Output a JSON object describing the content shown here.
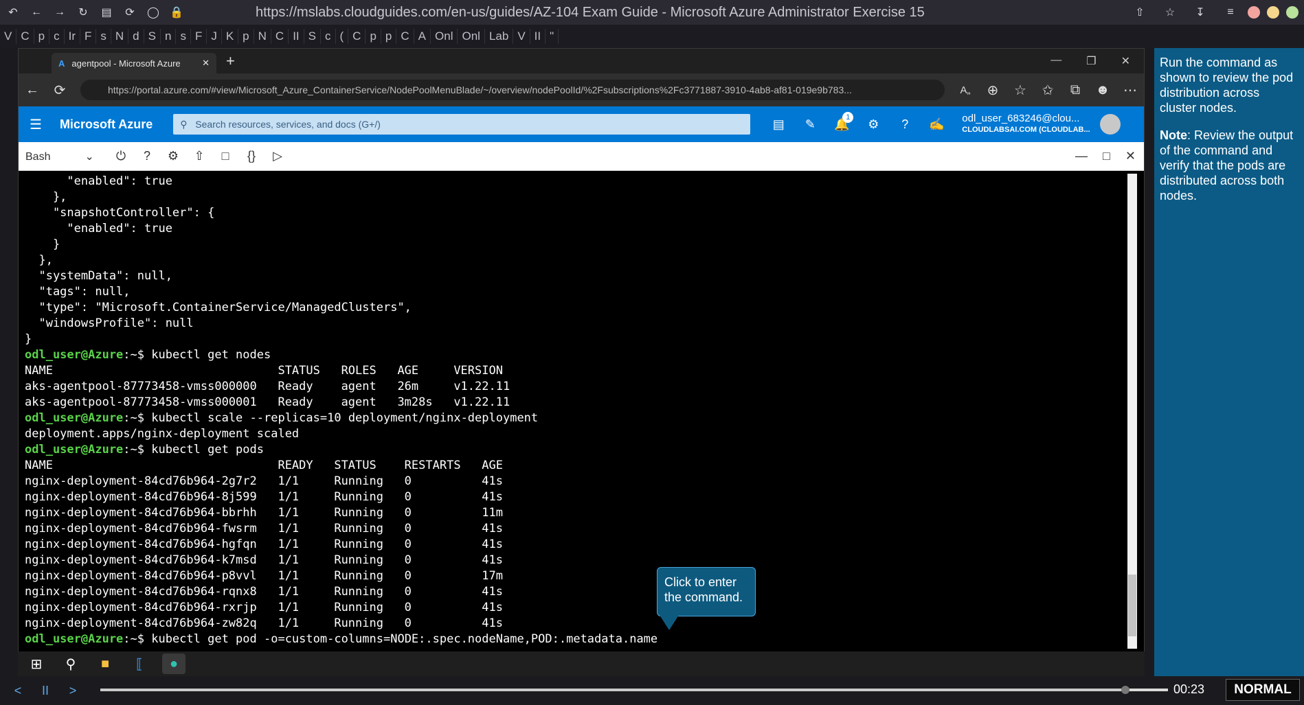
{
  "outer_browser": {
    "url": "https://mslabs.cloudguides.com/en-us/guides/AZ-104 Exam Guide - Microsoft Azure Administrator Exercise 15",
    "bookmarks": [
      "V",
      "C",
      "p",
      "c",
      "Ir",
      "F",
      "s",
      "N",
      "d",
      "S",
      "n",
      "s",
      "F",
      "J",
      "K",
      "p",
      "N",
      "C",
      "II",
      "S",
      "c",
      "(",
      "C",
      "p",
      "p",
      "C",
      "A",
      "Onl",
      "Onl",
      "Lab",
      "V",
      "II",
      "\""
    ]
  },
  "edge": {
    "tab_title": "agentpool - Microsoft Azure",
    "url": "https://portal.azure.com/#view/Microsoft_Azure_ContainerService/NodePoolMenuBlade/~/overview/nodePoolId/%2Fsubscriptions%2Fc3771887-3910-4ab8-af81-019e9b783..."
  },
  "azure": {
    "title": "Microsoft Azure",
    "search_placeholder": "Search resources, services, and docs (G+/)",
    "notification_count": "1",
    "user_name": "odl_user_683246@clou...",
    "user_org": "CLOUDLABSAI.COM (CLOUDLAB..."
  },
  "cloudshell": {
    "shell": "Bash"
  },
  "terminal": {
    "lines": [
      "      \"enabled\": true",
      "    },",
      "    \"snapshotController\": {",
      "      \"enabled\": true",
      "    }",
      "  },",
      "  \"systemData\": null,",
      "  \"tags\": null,",
      "  \"type\": \"Microsoft.ContainerService/ManagedClusters\",",
      "  \"windowsProfile\": null",
      "}",
      {
        "prompt": "odl_user@Azure",
        "cmd": ":~$ kubectl get nodes"
      },
      "NAME                                STATUS   ROLES   AGE     VERSION",
      "aks-agentpool-87773458-vmss000000   Ready    agent   26m     v1.22.11",
      "aks-agentpool-87773458-vmss000001   Ready    agent   3m28s   v1.22.11",
      {
        "prompt": "odl_user@Azure",
        "cmd": ":~$ kubectl scale --replicas=10 deployment/nginx-deployment"
      },
      "deployment.apps/nginx-deployment scaled",
      {
        "prompt": "odl_user@Azure",
        "cmd": ":~$ kubectl get pods"
      },
      "NAME                                READY   STATUS    RESTARTS   AGE",
      "nginx-deployment-84cd76b964-2g7r2   1/1     Running   0          41s",
      "nginx-deployment-84cd76b964-8j599   1/1     Running   0          41s",
      "nginx-deployment-84cd76b964-bbrhh   1/1     Running   0          11m",
      "nginx-deployment-84cd76b964-fwsrm   1/1     Running   0          41s",
      "nginx-deployment-84cd76b964-hgfqn   1/1     Running   0          41s",
      "nginx-deployment-84cd76b964-k7msd   1/1     Running   0          41s",
      "nginx-deployment-84cd76b964-p8vvl   1/1     Running   0          17m",
      "nginx-deployment-84cd76b964-rqnx8   1/1     Running   0          41s",
      "nginx-deployment-84cd76b964-rxrjp   1/1     Running   0          41s",
      "nginx-deployment-84cd76b964-zw82q   1/1     Running   0          41s",
      {
        "prompt": "odl_user@Azure",
        "cmd": ":~$ kubectl get pod -o=custom-columns=NODE:.spec.nodeName,POD:.metadata.name"
      }
    ]
  },
  "callout": {
    "text": "Click to enter the command."
  },
  "sidebar": {
    "instruction": "Run the command as shown to review the pod distribution across cluster nodes.",
    "note_label": "Note",
    "note_text": ": Review the output of the command and verify that the pods are distributed across both nodes."
  },
  "player": {
    "time": "00:23",
    "mode": "NORMAL",
    "progress": 0.96
  },
  "colors": {
    "azure_blue": "#0078d4",
    "prompt_green": "#5ad34a",
    "sidebar_blue": "#0c5b86"
  }
}
